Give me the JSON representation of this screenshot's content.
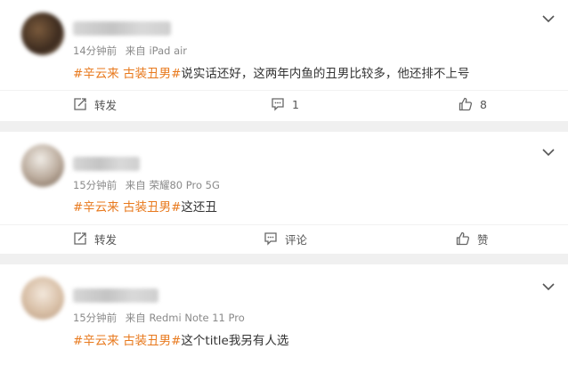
{
  "colors": {
    "tag": "#e8791d",
    "meta": "#8a8a8a",
    "text": "#333333",
    "background": "#f0f0f0"
  },
  "posts": [
    {
      "time": "14分钟前",
      "source": "来自 iPad air",
      "tag": "#辛云来 古装丑男#",
      "text": "说实话还好，这两年内鱼的丑男比较多，他还排不上号",
      "repost_label": "转发",
      "comment_label": "1",
      "like_label": "8",
      "icons": [
        "chevron-down-icon",
        "repost-icon",
        "comment-icon",
        "like-icon"
      ]
    },
    {
      "time": "15分钟前",
      "source": "来自 荣耀80 Pro 5G",
      "tag": "#辛云来 古装丑男#",
      "text": "这还丑",
      "repost_label": "转发",
      "comment_label": "评论",
      "like_label": "赞",
      "icons": [
        "chevron-down-icon",
        "repost-icon",
        "comment-icon",
        "like-icon"
      ]
    },
    {
      "time": "15分钟前",
      "source": "来自 Redmi Note 11 Pro",
      "tag": "#辛云来 古装丑男#",
      "text": "这个title我另有人选",
      "icons": [
        "chevron-down-icon"
      ]
    }
  ]
}
